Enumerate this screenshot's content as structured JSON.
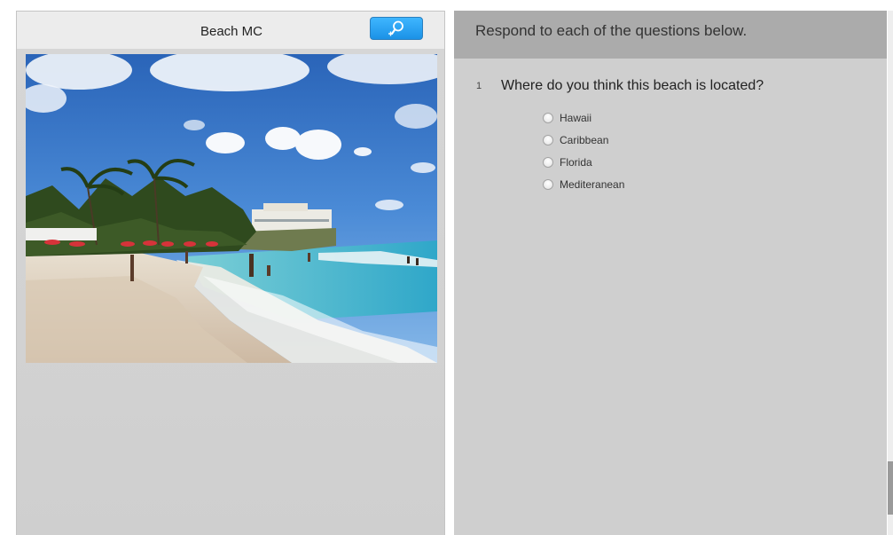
{
  "stimulus": {
    "title": "Beach MC",
    "zoom_icon": "zoom-in-icon",
    "image_subject": "beach-photo"
  },
  "questions_panel": {
    "instructions": "Respond to each of the questions below.",
    "question": {
      "number": "1",
      "text": "Where do you think this beach is located?",
      "options": [
        "Hawaii",
        "Caribbean",
        "Florida",
        "Mediteranean"
      ],
      "selected": null
    }
  },
  "colors": {
    "zoom_button": "#1b92e6",
    "panel_background": "#cfcfcf",
    "instructions_bar": "#ababab"
  }
}
